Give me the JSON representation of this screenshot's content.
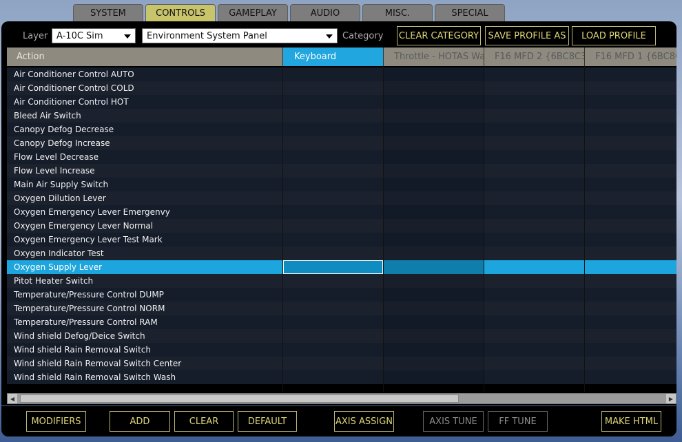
{
  "tabs": [
    {
      "label": "SYSTEM"
    },
    {
      "label": "CONTROLS"
    },
    {
      "label": "GAMEPLAY"
    },
    {
      "label": "AUDIO"
    },
    {
      "label": "MISC."
    },
    {
      "label": "SPECIAL"
    }
  ],
  "active_tab": "CONTROLS",
  "topbar": {
    "layer_label": "Layer",
    "layer_value": "A-10C Sim",
    "category_value": "Environment System Panel",
    "category_label": "Category",
    "clear_category": "CLEAR CATEGORY",
    "save_profile_as": "SAVE PROFILE AS",
    "load_profile": "LOAD PROFILE"
  },
  "columns": [
    "Action",
    "Keyboard",
    "Throttle - HOTAS Wa",
    "F16 MFD 2 {6BC8C3",
    "F16 MFD 1 {6BC8C"
  ],
  "rows": [
    "Air Conditioner Control AUTO",
    "Air Conditioner Control COLD",
    "Air Conditioner Control HOT",
    "Bleed Air Switch",
    "Canopy Defog Decrease",
    "Canopy Defog Increase",
    "Flow Level Decrease",
    "Flow Level Increase",
    "Main Air Supply Switch",
    "Oxygen Dilution Lever",
    "Oxygen Emergency Lever Emergenvy",
    "Oxygen Emergency Lever Normal",
    "Oxygen Emergency Lever Test Mark",
    "Oxygen Indicator Test",
    "Oxygen Supply Lever",
    "Pitot Heater Switch",
    "Temperature/Pressure Control DUMP",
    "Temperature/Pressure Control NORM",
    "Temperature/Pressure Control RAM",
    "Wind shield Defog/Deice Switch",
    "Wind shield Rain Removal Switch",
    "Wind shield Rain Removal Switch Center",
    "Wind shield Rain Removal Switch Wash"
  ],
  "selected_row": "Oxygen Supply Lever",
  "bottom": {
    "modifiers": "MODIFIERS",
    "add": "ADD",
    "clear": "CLEAR",
    "default": "DEFAULT",
    "axis_assign": "AXIS ASSIGN",
    "axis_tune": "AXIS TUNE",
    "ff_tune": "FF TUNE",
    "make_html": "MAKE HTML"
  },
  "colors": {
    "active_tab": "#c8c46b",
    "accent": "#22a6df",
    "button_text": "#ddd679"
  }
}
